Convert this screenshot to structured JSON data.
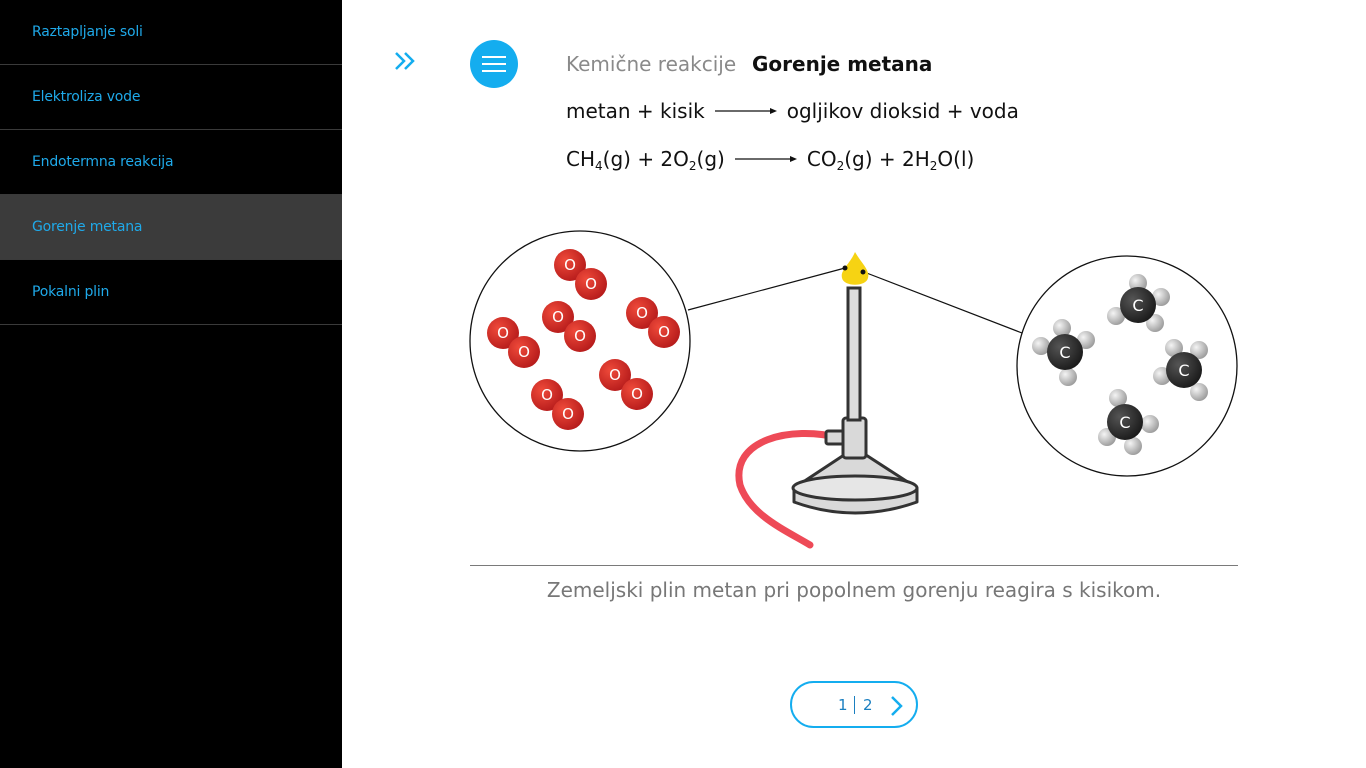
{
  "sidebar": {
    "items": [
      {
        "label": "Raztapljanje soli",
        "active": false
      },
      {
        "label": "Elektroliza vode",
        "active": false
      },
      {
        "label": "Endotermna reakcija",
        "active": false
      },
      {
        "label": "Gorenje metana",
        "active": true
      },
      {
        "label": "Pokalni plin",
        "active": false
      }
    ]
  },
  "header": {
    "breadcrumb": "Kemične reakcije",
    "title": "Gorenje metana"
  },
  "equations": {
    "word": {
      "left": "metan + kisik",
      "right": "ogljikov dioksid + voda"
    },
    "formula": {
      "left": [
        "CH",
        "4",
        "(g) + 2O",
        "2",
        "(g)"
      ],
      "right": [
        "CO",
        "2",
        "(g) + 2H",
        "2",
        "O(l)"
      ]
    }
  },
  "illustration": {
    "oxygen_atom_label": "O",
    "carbon_atom_label": "C"
  },
  "caption": "Zemeljski plin metan pri popolnem gorenju reagira s kisikom.",
  "pager": {
    "current": "1",
    "total": "2"
  },
  "colors": {
    "accent": "#14adef",
    "sidebar_bg": "#000000",
    "sidebar_active_bg": "#3b3b3b",
    "sidebar_text": "#1fa9e9",
    "oxygen": "#d42a2a",
    "hose": "#ee4a57",
    "flame": "#f6d313"
  },
  "icons": {
    "expand": "double-chevron-right-icon",
    "menu": "hamburger-menu-icon",
    "next": "chevron-right-icon"
  }
}
